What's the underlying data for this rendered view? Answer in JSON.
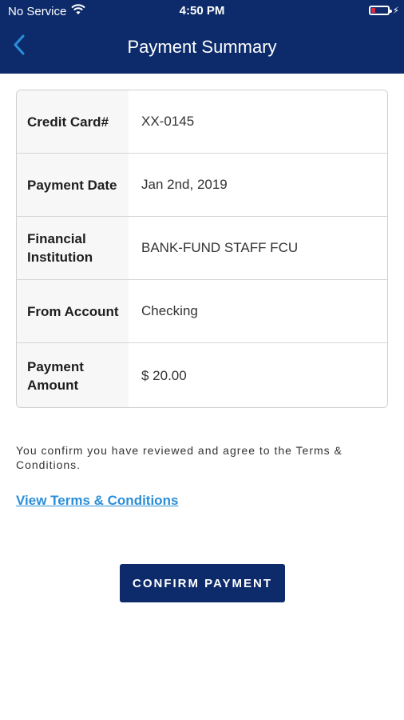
{
  "status_bar": {
    "carrier": "No Service",
    "time": "4:50 PM",
    "icons": [
      "wifi-icon",
      "battery-icon",
      "charging-icon"
    ],
    "battery_color": "#e0263b"
  },
  "header": {
    "title": "Payment Summary",
    "back_icon": "chevron-left-icon",
    "background": "#0d2b6b",
    "back_color": "#2a8ed8"
  },
  "summary": {
    "rows": [
      {
        "label": "Credit Card#",
        "value": "XX-0145"
      },
      {
        "label": "Payment Date",
        "value": "Jan 2nd, 2019"
      },
      {
        "label": "Financial Institution",
        "value": "BANK-FUND STAFF FCU"
      },
      {
        "label": "From Account",
        "value": "Checking"
      },
      {
        "label": "Payment Amount",
        "value": "$ 20.00"
      }
    ]
  },
  "confirmation": {
    "text": "You confirm you have reviewed and agree to the Terms & Conditions.",
    "link_label": "View Terms & Conditions",
    "link_color": "#2a8ed8"
  },
  "actions": {
    "confirm_label": "CONFIRM PAYMENT"
  }
}
